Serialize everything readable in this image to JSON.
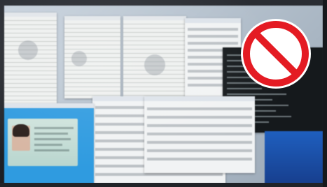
{
  "scene": {
    "subject": "photo-of-monitor",
    "overlay_symbol": "prohibited-icon",
    "colors": {
      "prohibit_red": "#e41b23",
      "prohibit_white": "#ffffff",
      "desktop_blue": "#1f5fbf",
      "terminal_bg": "#15191c"
    }
  }
}
